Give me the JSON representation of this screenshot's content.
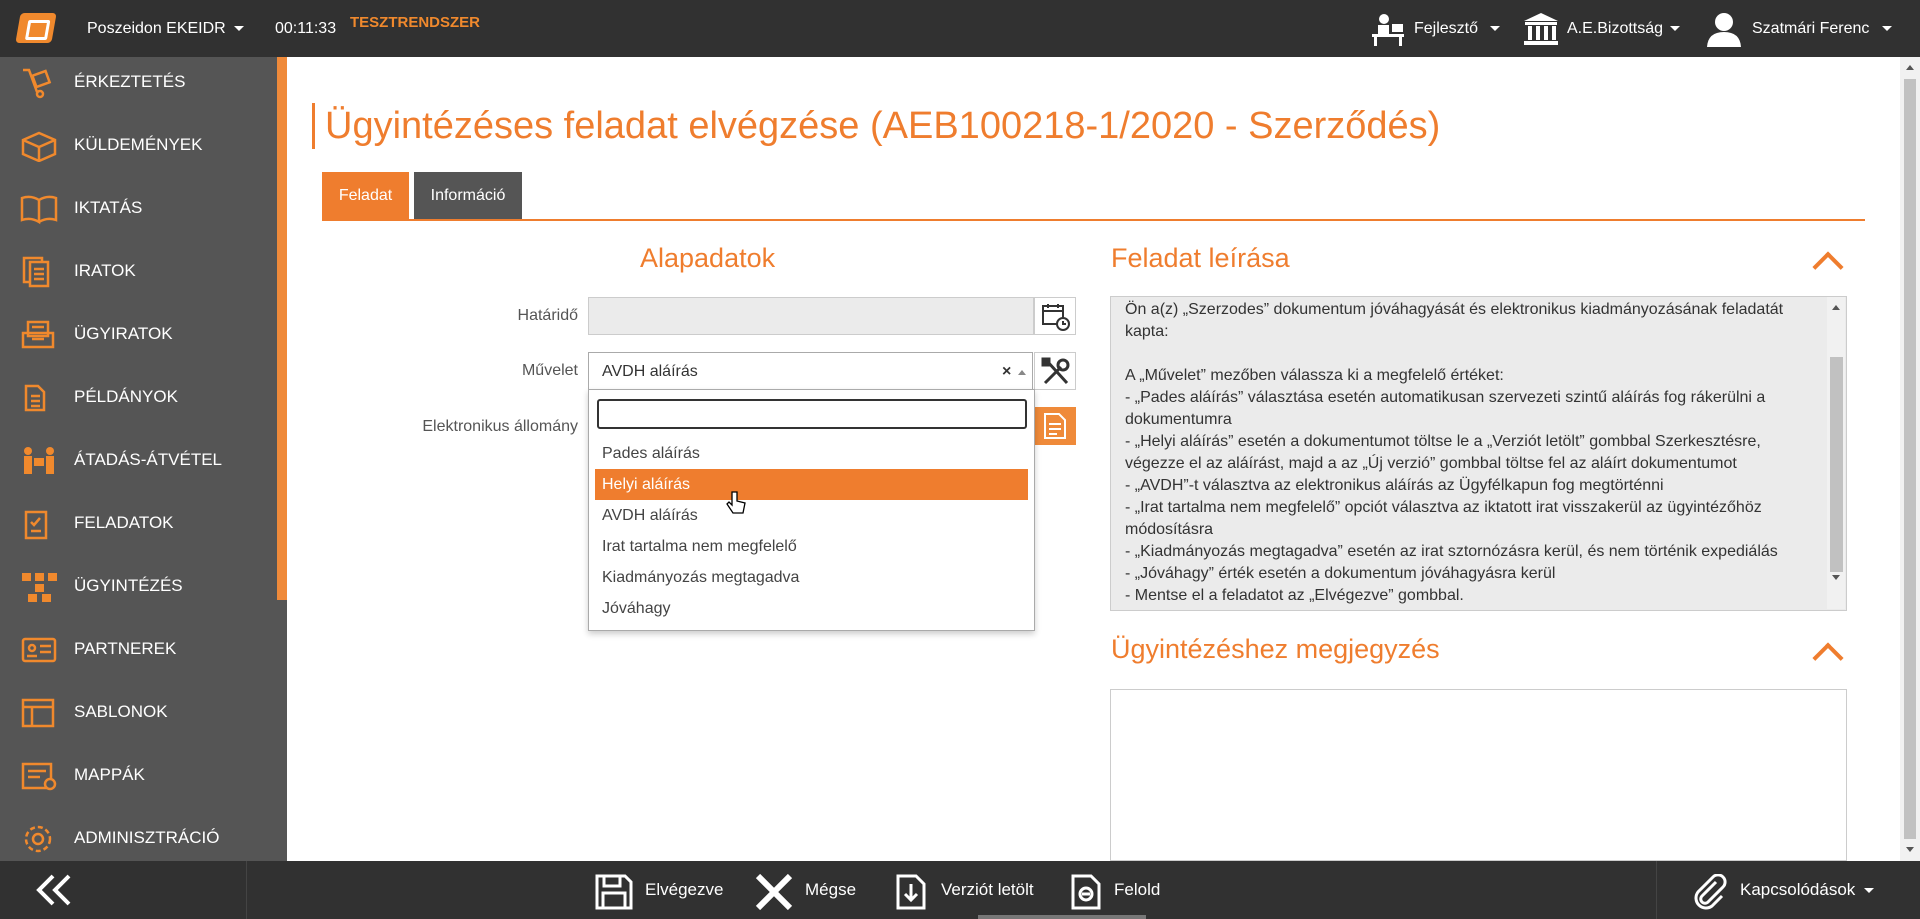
{
  "topbar": {
    "app_name": "Poszeidon EKEIDR",
    "timer": "00:11:33",
    "environment": "TESZTRENDSZER",
    "role": "Fejlesztő",
    "organization": "A.E.Bizottság",
    "user": "Szatmári Ferenc"
  },
  "sidebar": {
    "items": [
      {
        "label": "ÉRKEZTETÉS",
        "icon": "dolly-icon"
      },
      {
        "label": "KÜLDEMÉNYEK",
        "icon": "package-icon"
      },
      {
        "label": "IKTATÁS",
        "icon": "book-icon"
      },
      {
        "label": "IRATOK",
        "icon": "documents-icon"
      },
      {
        "label": "ÜGYIRATOK",
        "icon": "folder-stack-icon"
      },
      {
        "label": "PÉLDÁNYOK",
        "icon": "copy-icon"
      },
      {
        "label": "ÁTADÁS-ÁTVÉTEL",
        "icon": "handover-icon"
      },
      {
        "label": "FELADATOK",
        "icon": "clipboard-icon"
      },
      {
        "label": "ÜGYINTÉZÉS",
        "icon": "workflow-icon"
      },
      {
        "label": "PARTNEREK",
        "icon": "address-card-icon"
      },
      {
        "label": "SABLONOK",
        "icon": "template-icon"
      },
      {
        "label": "MAPPÁK",
        "icon": "folder-icon"
      },
      {
        "label": "ADMINISZTRÁCIÓ",
        "icon": "gear-icon"
      }
    ]
  },
  "page": {
    "title": "Ügyintézéses feladat elvégzése (AEB100218-1/2020 - Szerződés)",
    "tabs": [
      {
        "label": "Feladat",
        "active": true
      },
      {
        "label": "Információ",
        "active": false
      }
    ]
  },
  "form": {
    "heading": "Alapadatok",
    "deadline_label": "Határidő",
    "deadline_value": "",
    "operation_label": "Művelet",
    "operation_value": "AVDH aláírás",
    "electronic_label": "Elektronikus állomány",
    "search_value": "",
    "options": [
      {
        "label": "Pades aláírás",
        "highlighted": false
      },
      {
        "label": "Helyi aláírás",
        "highlighted": true
      },
      {
        "label": "AVDH aláírás",
        "highlighted": false
      },
      {
        "label": "Irat tartalma nem megfelelő",
        "highlighted": false
      },
      {
        "label": "Kiadmányozás megtagadva",
        "highlighted": false
      },
      {
        "label": "Jóváhagy",
        "highlighted": false
      }
    ]
  },
  "description": {
    "heading": "Feladat leírása",
    "text": "Ön a(z) „Szerzodes” dokumentum jóváhagyását és elektronikus kiadmányozásának feladatát kapta:\n\nA „Művelet” mezőben válassza ki a megfelelő értéket:\n- „Pades aláírás” választása esetén automatikusan szervezeti szintű aláírás fog rákerülni a dokumentumra\n- „Helyi aláírás” esetén a dokumentumot töltse le a „Verziót letölt” gombbal Szerkesztésre, végezze el az aláírást, majd a az „Új verzió” gombbal töltse fel az aláírt dokumentumot\n- „AVDH”-t választva az elektronikus aláírás az Ügyfélkapun fog megtörténni\n- „Irat tartalma nem megfelelő” opciót választva az iktatott irat visszakerül az ügyintézőhöz módosításra\n- „Kiadmányozás megtagadva” esetén az irat sztornózásra kerül, és nem történik expediálás\n- „Jóváhagy” érték esetén a dokumentum jóváhagyásra kerül\n- Mentse el a feladatot az „Elvégezve” gombbal."
  },
  "note": {
    "heading": "Ügyintézéshez megjegyzés",
    "value": ""
  },
  "bottombar": {
    "done": "Elvégezve",
    "cancel": "Mégse",
    "download": "Verziót letölt",
    "release": "Felold",
    "links": "Kapcsolódások"
  },
  "colors": {
    "accent": "#ef7d2e",
    "dark": "#313131",
    "sidebar": "#555555"
  }
}
